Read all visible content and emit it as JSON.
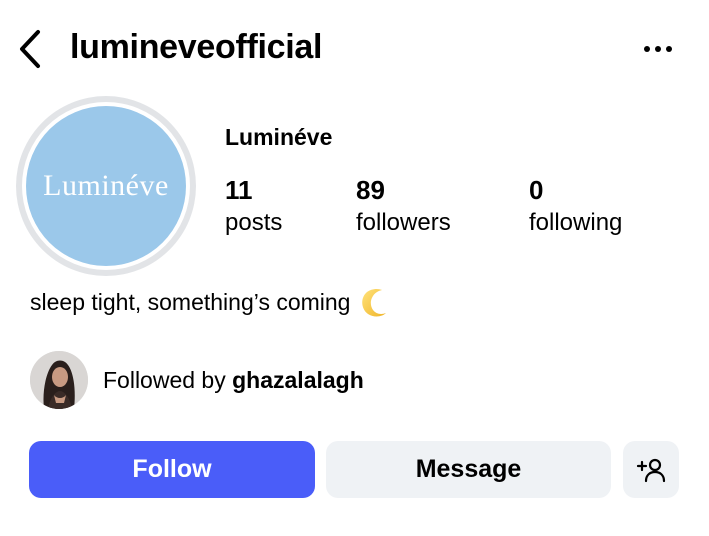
{
  "header": {
    "username": "lumineveofficial",
    "back_icon": "chevron-left-icon",
    "more_icon": "more-horizontal-icon"
  },
  "profile": {
    "avatar_text": "Luminéve",
    "avatar_bg": "#9bc8ea",
    "display_name": "Luminéve",
    "stats": [
      {
        "value": "11",
        "label": "posts"
      },
      {
        "value": "89",
        "label": "followers"
      },
      {
        "value": "0",
        "label": "following"
      }
    ],
    "bio": "sleep tight, something’s coming",
    "bio_icon": "crescent-moon-icon"
  },
  "followed_by": {
    "prefix": "Followed by ",
    "user": "ghazalalagh"
  },
  "actions": {
    "follow_label": "Follow",
    "message_label": "Message",
    "suggest_icon": "add-person-icon",
    "accent": "#4a5df9"
  }
}
